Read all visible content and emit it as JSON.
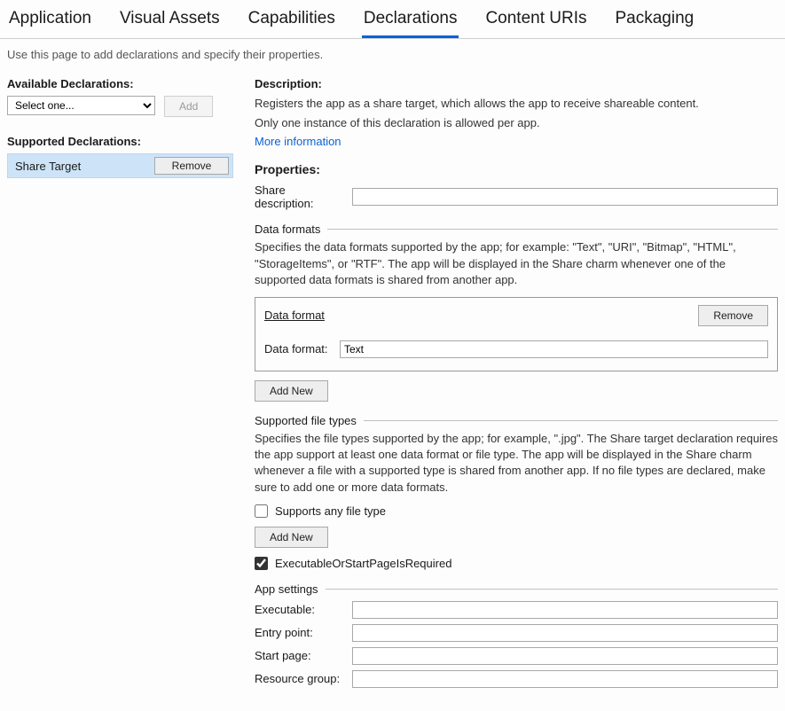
{
  "tabs": {
    "application": "Application",
    "visual_assets": "Visual Assets",
    "capabilities": "Capabilities",
    "declarations": "Declarations",
    "content_uris": "Content URIs",
    "packaging": "Packaging"
  },
  "intro": "Use this page to add declarations and specify their properties.",
  "left": {
    "available_label": "Available Declarations:",
    "dropdown_placeholder": "Select one...",
    "add_button": "Add",
    "supported_label": "Supported Declarations:",
    "supported_item": "Share Target",
    "remove_button": "Remove"
  },
  "right": {
    "description_label": "Description:",
    "desc_line1": "Registers the app as a share target, which allows the app to receive shareable content.",
    "desc_line2": "Only one instance of this declaration is allowed per app.",
    "more_info": "More information",
    "properties_label": "Properties:",
    "share_desc_label": "Share description:",
    "share_desc_value": "",
    "data_formats_heading": "Data formats",
    "data_formats_help": "Specifies the data formats supported by the app; for example: \"Text\", \"URI\", \"Bitmap\", \"HTML\", \"StorageItems\", or \"RTF\". The app will be displayed in the Share charm whenever one of the supported data formats is shared from another app.",
    "box_title": "Data format",
    "box_remove": "Remove",
    "box_field_label": "Data format:",
    "box_field_value": "Text",
    "add_new": "Add New",
    "sft_heading": "Supported file types",
    "sft_help": "Specifies the file types supported by the app; for example, \".jpg\". The Share target declaration requires the app support at least one data format or file type. The app will be displayed in the Share charm whenever a file with a supported type is shared from another app. If no file types are declared, make sure to add one or more data formats.",
    "supports_any": "Supports any file type",
    "exec_required": "ExecutableOrStartPageIsRequired",
    "app_settings_heading": "App settings",
    "executable_label": "Executable:",
    "executable_value": "",
    "entry_point_label": "Entry point:",
    "entry_point_value": "",
    "start_page_label": "Start page:",
    "start_page_value": "",
    "resource_group_label": "Resource group:",
    "resource_group_value": ""
  }
}
